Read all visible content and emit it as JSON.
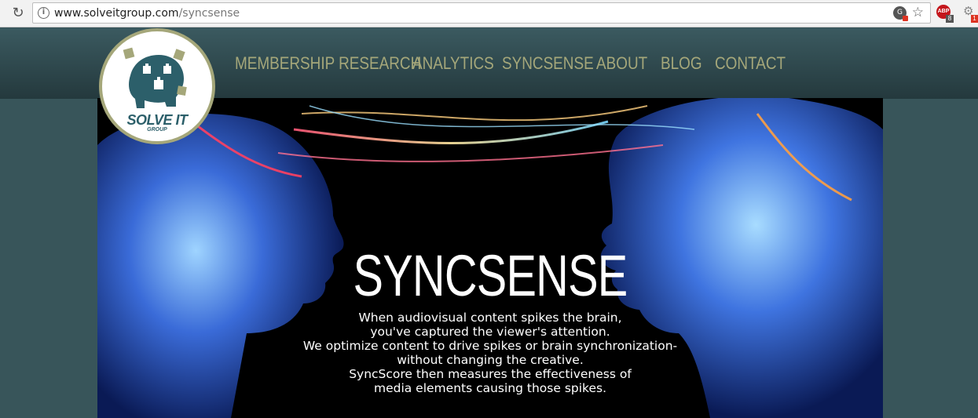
{
  "browser": {
    "url_domain": "www.solveitgroup.com",
    "url_path": "/syncsense",
    "adblock_count": "8",
    "extension_count": "1"
  },
  "logo": {
    "name": "SOLVE IT",
    "tagline": "GROUP"
  },
  "nav": {
    "items": [
      {
        "label": "MEMBERSHIP RESEARCH"
      },
      {
        "label": "ANALYTICS"
      },
      {
        "label": "SYNCSENSE"
      },
      {
        "label": "ABOUT"
      },
      {
        "label": "BLOG"
      },
      {
        "label": "CONTACT"
      }
    ]
  },
  "hero": {
    "title": "SYNCSENSE",
    "lines": [
      "When audiovisual content spikes the brain,",
      "you've captured the viewer's attention.",
      "We optimize content to drive spikes or brain synchronization-",
      "without changing the creative.",
      "SyncScore then measures the effectiveness of",
      "media elements causing those spikes."
    ]
  },
  "colors": {
    "nav_text": "#a5a77a",
    "header_bg": "#38555a",
    "logo_brand": "#2c5f6a"
  }
}
